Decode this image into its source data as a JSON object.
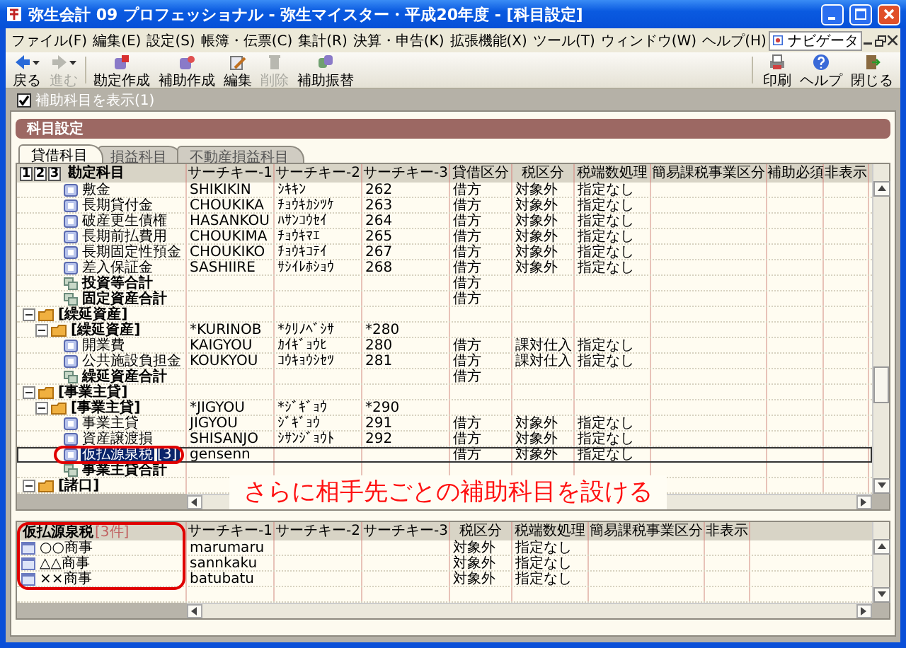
{
  "window": {
    "title": "弥生会計 09 プロフェッショナル - 弥生マイスター・平成20年度 - [科目設定]"
  },
  "menu_bar": {
    "items": [
      "ファイル(F)",
      "編集(E)",
      "設定(S)",
      "帳簿・伝票(C)",
      "集計(R)",
      "決算・申告(K)",
      "拡張機能(X)",
      "ツール(T)",
      "ウィンドウ(W)",
      "ヘルプ(H)"
    ],
    "navigator": "ナビゲータ"
  },
  "toolbar": {
    "left": [
      {
        "kind": "back",
        "label": "戻る",
        "disabled": false,
        "dropdown": true
      },
      {
        "kind": "forward",
        "label": "進む",
        "disabled": true,
        "dropdown": true
      },
      {
        "kind": "create",
        "label": "勘定作成",
        "disabled": false
      },
      {
        "kind": "subcreate",
        "label": "補助作成",
        "disabled": false
      },
      {
        "kind": "edit",
        "label": "編集",
        "disabled": false
      },
      {
        "kind": "delete",
        "label": "削除",
        "disabled": true
      },
      {
        "kind": "transfer",
        "label": "補助振替",
        "disabled": false
      }
    ],
    "right": [
      {
        "kind": "print",
        "label": "印刷",
        "disabled": false
      },
      {
        "kind": "help",
        "label": "ヘルプ",
        "disabled": false
      },
      {
        "kind": "close",
        "label": "閉じる",
        "disabled": false
      }
    ]
  },
  "show_sub_accounts": {
    "label": "補助科目を表示(1)",
    "checked": true
  },
  "panel": {
    "title": "科目設定",
    "tabs": [
      {
        "label": "貸借科目",
        "selected": true
      },
      {
        "label": "損益科目",
        "selected": false
      },
      {
        "label": "不動産損益科目",
        "selected": false
      }
    ]
  },
  "account_grid": {
    "level_buttons": [
      "1",
      "2",
      "3"
    ],
    "columns": [
      "勘定科目",
      "サーチキー-1",
      "サーチキー-2",
      "サーチキー-3",
      "貸借区分",
      "税区分",
      "税端数処理",
      "簡易課税事業区分",
      "補助必須",
      "非表示"
    ],
    "continued_rows": [
      {
        "kind": "account",
        "name": "敷金",
        "selected": false,
        "search_key_1": "SHIKIKIN",
        "search_key_2": "ｼｷｷﾝ",
        "search_key_3": "262",
        "debit_credit": "借方",
        "tax_category": "対象外",
        "tax_rounding": "指定なし"
      },
      {
        "kind": "account",
        "name": "長期貸付金",
        "selected": false,
        "search_key_1": "CHOUKIKA",
        "search_key_2": "ﾁｮｳｷｶｼﾂｹ",
        "search_key_3": "263",
        "debit_credit": "借方",
        "tax_category": "対象外",
        "tax_rounding": "指定なし"
      },
      {
        "kind": "account",
        "name": "破産更生債権",
        "selected": false,
        "search_key_1": "HASANKOU",
        "search_key_2": "ﾊｻﾝｺｳｾｲ",
        "search_key_3": "264",
        "debit_credit": "借方",
        "tax_category": "対象外",
        "tax_rounding": "指定なし"
      },
      {
        "kind": "account",
        "name": "長期前払費用",
        "selected": false,
        "search_key_1": "CHOUKIMA",
        "search_key_2": "ﾁｮｳｷﾏｴ",
        "search_key_3": "265",
        "debit_credit": "借方",
        "tax_category": "対象外",
        "tax_rounding": "指定なし"
      },
      {
        "kind": "account",
        "name": "長期固定性預金",
        "selected": false,
        "search_key_1": "CHOUKIKO",
        "search_key_2": "ﾁｮｳｷｺﾃｲ",
        "search_key_3": "267",
        "debit_credit": "借方",
        "tax_category": "対象外",
        "tax_rounding": "指定なし"
      },
      {
        "kind": "account",
        "name": "差入保証金",
        "selected": false,
        "search_key_1": "SASHIIRE",
        "search_key_2": "ｻｼｲﾚﾎｼｮｳ",
        "search_key_3": "268",
        "debit_credit": "借方",
        "tax_category": "対象外",
        "tax_rounding": "指定なし"
      },
      {
        "kind": "total",
        "name": "投資等合計",
        "selected": false,
        "debit_credit": "借方"
      },
      {
        "kind": "total",
        "name": "固定資産合計",
        "selected": false,
        "debit_credit": "借方"
      }
    ],
    "rows": [
      {
        "kind": "group",
        "name": "[繰延資産]",
        "expanded": true,
        "selected": false,
        "children": [
          {
            "kind": "group",
            "name": "[繰延資産]",
            "expanded": true,
            "selected": false,
            "search_key_1": "*KURINOB",
            "search_key_2": "*ｸﾘﾉﾍﾞｼｻ",
            "search_key_3": "*280",
            "children": [
              {
                "kind": "account",
                "name": "開業費",
                "selected": false,
                "search_key_1": "KAIGYOU",
                "search_key_2": "ｶｲｷﾞｮｳﾋ",
                "search_key_3": "280",
                "debit_credit": "借方",
                "tax_category": "課対仕入",
                "tax_rounding": "指定なし"
              },
              {
                "kind": "account",
                "name": "公共施設負担金",
                "selected": false,
                "search_key_1": "KOUKYOU",
                "search_key_2": "ｺｳｷｮｳｼｾﾂ",
                "search_key_3": "281",
                "debit_credit": "借方",
                "tax_category": "課対仕入",
                "tax_rounding": "指定なし"
              },
              {
                "kind": "total",
                "name": "繰延資産合計",
                "selected": false,
                "debit_credit": "借方"
              }
            ]
          }
        ]
      },
      {
        "kind": "group",
        "name": "[事業主貸]",
        "expanded": true,
        "selected": false,
        "children": [
          {
            "kind": "group",
            "name": "[事業主貸]",
            "expanded": true,
            "selected": false,
            "search_key_1": "*JIGYOU",
            "search_key_2": "*ｼﾞｷﾞｮｳ",
            "search_key_3": "*290",
            "children": [
              {
                "kind": "account",
                "name": "事業主貸",
                "selected": false,
                "search_key_1": "JIGYOU",
                "search_key_2": "ｼﾞｷﾞｮｳ",
                "search_key_3": "291",
                "debit_credit": "借方",
                "tax_category": "対象外",
                "tax_rounding": "指定なし"
              },
              {
                "kind": "account",
                "name": "資産譲渡損",
                "selected": false,
                "search_key_1": "SHISANJO",
                "search_key_2": "ｼｻﾝｼﾞｮｳﾄ",
                "search_key_3": "292",
                "debit_credit": "借方",
                "tax_category": "対象外",
                "tax_rounding": "指定なし"
              },
              {
                "kind": "account",
                "name": "仮払源泉税",
                "sub_count": "[3]",
                "selected": true,
                "search_key_1": "gensenn",
                "debit_credit": "借方",
                "tax_category": "対象外",
                "tax_rounding": "指定なし"
              },
              {
                "kind": "total",
                "name": "事業主貸合計",
                "selected": false
              }
            ]
          }
        ]
      },
      {
        "kind": "group",
        "name": "[諸口]",
        "expanded": true,
        "selected": false
      }
    ]
  },
  "sub_account_grid": {
    "account": "仮払源泉税",
    "count": "[3件]",
    "columns": [
      "サーチキー-1",
      "サーチキー-2",
      "サーチキー-3",
      "税区分",
      "税端数処理",
      "簡易課税事業区分",
      "非表示"
    ],
    "rows": [
      {
        "name": "○○商事",
        "search_key_1": "marumaru",
        "tax_category": "対象外",
        "tax_rounding": "指定なし"
      },
      {
        "name": "△△商事",
        "search_key_1": "sannkaku",
        "tax_category": "対象外",
        "tax_rounding": "指定なし"
      },
      {
        "name": "××商事",
        "search_key_1": "batubatu",
        "tax_category": "対象外",
        "tax_rounding": "指定なし"
      }
    ]
  },
  "callout": "さらに相手先ごとの補助科目を設ける"
}
